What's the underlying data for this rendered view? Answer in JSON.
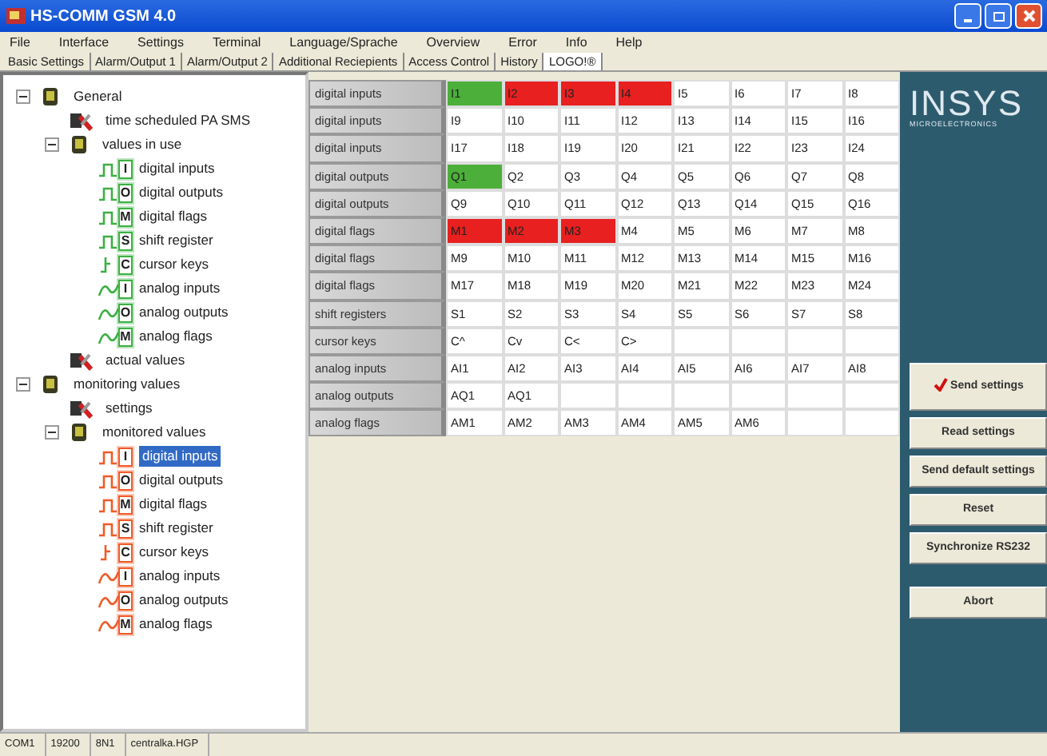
{
  "window": {
    "title": "HS-COMM GSM 4.0"
  },
  "menu": [
    "File",
    "Interface",
    "Settings",
    "Terminal",
    "Language/Sprache",
    "Overview",
    "Error",
    "Info",
    "Help"
  ],
  "tabs": [
    {
      "label": "Basic Settings",
      "selected": false
    },
    {
      "label": "Alarm/Output 1",
      "selected": false
    },
    {
      "label": "Alarm/Output 2",
      "selected": false
    },
    {
      "label": "Additional Reciepients",
      "selected": false
    },
    {
      "label": "Access Control",
      "selected": false
    },
    {
      "label": "History",
      "selected": false
    },
    {
      "label": "LOGO!®",
      "selected": true
    }
  ],
  "tree": [
    {
      "label": "General",
      "kind": "folder",
      "expanded": true,
      "selected": false,
      "children": [
        {
          "label": "time scheduled PA SMS",
          "kind": "tool",
          "selected": false
        },
        {
          "label": "values in use",
          "kind": "folder",
          "expanded": true,
          "selected": false,
          "children": [
            {
              "label": "digital inputs",
              "kind": "digital",
              "badge": "I",
              "color": "#3cb043",
              "selected": false
            },
            {
              "label": "digital outputs",
              "kind": "digital",
              "badge": "O",
              "color": "#3cb043",
              "selected": false
            },
            {
              "label": "digital flags",
              "kind": "digital",
              "badge": "M",
              "color": "#3cb043",
              "selected": false
            },
            {
              "label": "shift register",
              "kind": "digital",
              "badge": "S",
              "color": "#3cb043",
              "selected": false
            },
            {
              "label": "cursor keys",
              "kind": "cursor",
              "badge": "C",
              "color": "#3cb043",
              "selected": false
            },
            {
              "label": "analog inputs",
              "kind": "analog",
              "badge": "I",
              "color": "#3cb043",
              "selected": false
            },
            {
              "label": "analog outputs",
              "kind": "analog",
              "badge": "O",
              "color": "#3cb043",
              "selected": false
            },
            {
              "label": "analog flags",
              "kind": "analog",
              "badge": "M",
              "color": "#3cb043",
              "selected": false
            }
          ]
        },
        {
          "label": "actual values",
          "kind": "tool",
          "selected": false
        }
      ]
    },
    {
      "label": "monitoring values",
      "kind": "folder",
      "expanded": true,
      "selected": false,
      "children": [
        {
          "label": "settings",
          "kind": "tool",
          "selected": false
        },
        {
          "label": "monitored values",
          "kind": "folder",
          "expanded": true,
          "selected": false,
          "children": [
            {
              "label": "digital inputs",
              "kind": "digital",
              "badge": "I",
              "color": "#f05a28",
              "selected": true
            },
            {
              "label": "digital outputs",
              "kind": "digital",
              "badge": "O",
              "color": "#f05a28",
              "selected": false
            },
            {
              "label": "digital flags",
              "kind": "digital",
              "badge": "M",
              "color": "#f05a28",
              "selected": false
            },
            {
              "label": "shift register",
              "kind": "digital",
              "badge": "S",
              "color": "#f05a28",
              "selected": false
            },
            {
              "label": "cursor keys",
              "kind": "cursor",
              "badge": "C",
              "color": "#f05a28",
              "selected": false
            },
            {
              "label": "analog inputs",
              "kind": "analog",
              "badge": "I",
              "color": "#f05a28",
              "selected": false
            },
            {
              "label": "analog outputs",
              "kind": "analog",
              "badge": "O",
              "color": "#f05a28",
              "selected": false
            },
            {
              "label": "analog flags",
              "kind": "analog",
              "badge": "M",
              "color": "#f05a28",
              "selected": false
            }
          ]
        }
      ]
    }
  ],
  "table": {
    "rows": [
      {
        "label": "digital inputs",
        "cells": [
          {
            "text": "I1",
            "color": "#4caf3a"
          },
          {
            "text": "I2",
            "color": "#e82020"
          },
          {
            "text": "I3",
            "color": "#e82020"
          },
          {
            "text": "I4",
            "color": "#e82020"
          },
          {
            "text": "I5"
          },
          {
            "text": "I6"
          },
          {
            "text": "I7"
          },
          {
            "text": "I8"
          }
        ]
      },
      {
        "label": "digital inputs",
        "cells": [
          {
            "text": "I9"
          },
          {
            "text": "I10"
          },
          {
            "text": "I11"
          },
          {
            "text": "I12"
          },
          {
            "text": "I13"
          },
          {
            "text": "I14"
          },
          {
            "text": "I15"
          },
          {
            "text": "I16"
          }
        ]
      },
      {
        "label": "digital inputs",
        "cells": [
          {
            "text": "I17"
          },
          {
            "text": "I18"
          },
          {
            "text": "I19"
          },
          {
            "text": "I20"
          },
          {
            "text": "I21"
          },
          {
            "text": "I22"
          },
          {
            "text": "I23"
          },
          {
            "text": "I24"
          }
        ]
      },
      {
        "label": "digital outputs",
        "cells": [
          {
            "text": "Q1",
            "color": "#4caf3a"
          },
          {
            "text": "Q2"
          },
          {
            "text": "Q3"
          },
          {
            "text": "Q4"
          },
          {
            "text": "Q5"
          },
          {
            "text": "Q6"
          },
          {
            "text": "Q7"
          },
          {
            "text": "Q8"
          }
        ]
      },
      {
        "label": "digital outputs",
        "cells": [
          {
            "text": "Q9"
          },
          {
            "text": "Q10"
          },
          {
            "text": "Q11"
          },
          {
            "text": "Q12"
          },
          {
            "text": "Q13"
          },
          {
            "text": "Q14"
          },
          {
            "text": "Q15"
          },
          {
            "text": "Q16"
          }
        ]
      },
      {
        "label": "digital flags",
        "cells": [
          {
            "text": "M1",
            "color": "#e82020"
          },
          {
            "text": "M2",
            "color": "#e82020"
          },
          {
            "text": "M3",
            "color": "#e82020"
          },
          {
            "text": "M4"
          },
          {
            "text": "M5"
          },
          {
            "text": "M6"
          },
          {
            "text": "M7"
          },
          {
            "text": "M8"
          }
        ]
      },
      {
        "label": "digital flags",
        "cells": [
          {
            "text": "M9"
          },
          {
            "text": "M10"
          },
          {
            "text": "M11"
          },
          {
            "text": "M12"
          },
          {
            "text": "M13"
          },
          {
            "text": "M14"
          },
          {
            "text": "M15"
          },
          {
            "text": "M16"
          }
        ]
      },
      {
        "label": "digital flags",
        "cells": [
          {
            "text": "M17"
          },
          {
            "text": "M18"
          },
          {
            "text": "M19"
          },
          {
            "text": "M20"
          },
          {
            "text": "M21"
          },
          {
            "text": "M22"
          },
          {
            "text": "M23"
          },
          {
            "text": "M24"
          }
        ]
      },
      {
        "label": "shift registers",
        "cells": [
          {
            "text": "S1"
          },
          {
            "text": "S2"
          },
          {
            "text": "S3"
          },
          {
            "text": "S4"
          },
          {
            "text": "S5"
          },
          {
            "text": "S6"
          },
          {
            "text": "S7"
          },
          {
            "text": "S8"
          }
        ]
      },
      {
        "label": "cursor keys",
        "cells": [
          {
            "text": "C^"
          },
          {
            "text": "Cv"
          },
          {
            "text": "C<"
          },
          {
            "text": "C>"
          }
        ]
      },
      {
        "label": "analog inputs",
        "cells": [
          {
            "text": "AI1"
          },
          {
            "text": "AI2"
          },
          {
            "text": "AI3"
          },
          {
            "text": "AI4"
          },
          {
            "text": "AI5"
          },
          {
            "text": "AI6"
          },
          {
            "text": "AI7"
          },
          {
            "text": "AI8"
          }
        ]
      },
      {
        "label": "analog outputs",
        "cells": [
          {
            "text": "AQ1"
          },
          {
            "text": "AQ1"
          }
        ]
      },
      {
        "label": "analog flags",
        "cells": [
          {
            "text": "AM1"
          },
          {
            "text": "AM2"
          },
          {
            "text": "AM3"
          },
          {
            "text": "AM4"
          },
          {
            "text": "AM5"
          },
          {
            "text": "AM6"
          }
        ]
      }
    ]
  },
  "brand": {
    "name": "INSYS",
    "tagline": "MICROELECTRONICS"
  },
  "buttons": [
    {
      "label": "Send settings",
      "checked": true
    },
    {
      "label": "Read settings",
      "checked": false
    },
    {
      "label": "Send default settings",
      "checked": false
    },
    {
      "label": "Reset",
      "checked": false
    },
    {
      "label": "Synchronize RS232",
      "checked": false
    },
    {
      "label": "Abort",
      "checked": false
    }
  ],
  "status_bar": [
    "COM1",
    "19200",
    "8N1",
    "centralka.HGP"
  ]
}
